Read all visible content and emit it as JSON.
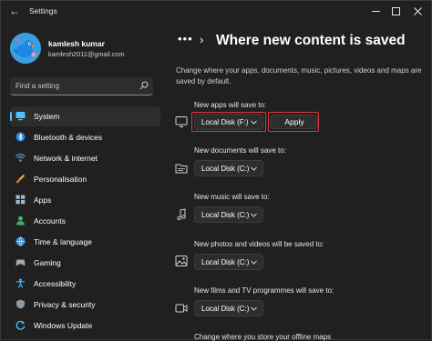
{
  "window": {
    "title": "Settings"
  },
  "user": {
    "name": "kamlesh kumar",
    "email": "kamlesh2011@gmail.com"
  },
  "search": {
    "placeholder": "Find a setting"
  },
  "sidebar": {
    "items": [
      {
        "label": "System",
        "icon": "monitor-icon",
        "active": true
      },
      {
        "label": "Bluetooth & devices",
        "icon": "bluetooth-icon"
      },
      {
        "label": "Network & internet",
        "icon": "wifi-icon"
      },
      {
        "label": "Personalisation",
        "icon": "brush-icon"
      },
      {
        "label": "Apps",
        "icon": "apps-icon"
      },
      {
        "label": "Accounts",
        "icon": "person-icon"
      },
      {
        "label": "Time & language",
        "icon": "globe-icon"
      },
      {
        "label": "Gaming",
        "icon": "gamepad-icon"
      },
      {
        "label": "Accessibility",
        "icon": "accessibility-icon"
      },
      {
        "label": "Privacy & security",
        "icon": "shield-icon"
      },
      {
        "label": "Windows Update",
        "icon": "update-icon"
      }
    ]
  },
  "breadcrumb": {
    "dots": "•••",
    "chevron": "›"
  },
  "page": {
    "title": "Where new content is saved",
    "description": "Change where your apps, documents, music, pictures, videos and maps are saved by default."
  },
  "sections": [
    {
      "label": "New apps will save to:",
      "value": "Local Disk (F:)",
      "icon": "monitor-icon",
      "apply": "Apply"
    },
    {
      "label": "New documents will save to:",
      "value": "Local Disk (C:)",
      "icon": "folder-icon"
    },
    {
      "label": "New music will save to:",
      "value": "Local Disk (C:)",
      "icon": "music-note-icon"
    },
    {
      "label": "New photos and videos will be saved to:",
      "value": "Local Disk (C:)",
      "icon": "photo-icon"
    },
    {
      "label": "New films and TV programmes will save to:",
      "value": "Local Disk (C:)",
      "icon": "video-icon"
    },
    {
      "label": "Change where you store your offline maps"
    }
  ],
  "colors": {
    "accent": "#4cc2ff",
    "highlight": "#e0353b",
    "background": "#202020"
  }
}
